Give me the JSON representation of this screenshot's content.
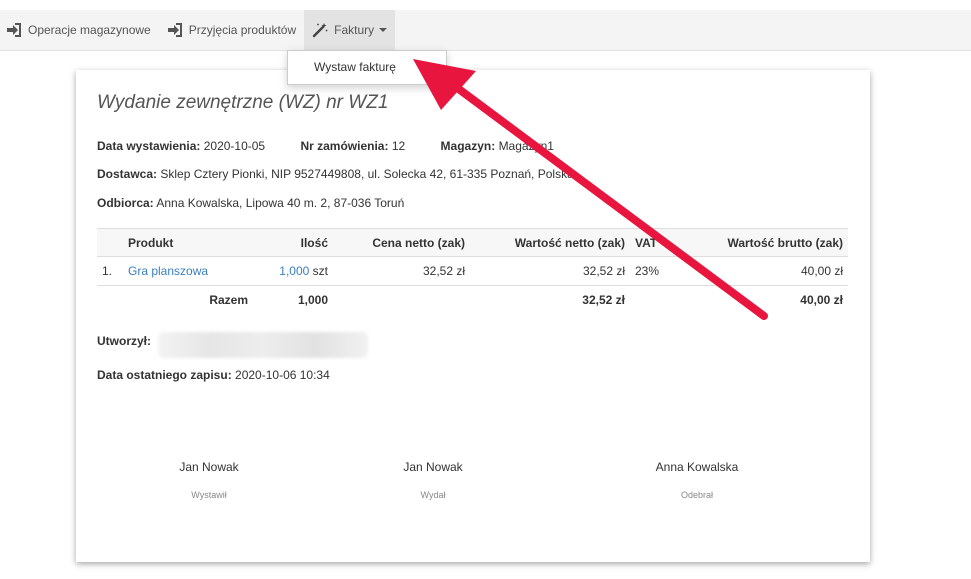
{
  "navbar": {
    "items": [
      {
        "label": "Operacje magazynowe",
        "icon": "sign-in-icon"
      },
      {
        "label": "Przyjęcia produktów",
        "icon": "sign-in-icon"
      },
      {
        "label": "Faktury",
        "icon": "magic-wand-icon"
      }
    ]
  },
  "dropdown": {
    "items": [
      {
        "label": "Wystaw fakturę"
      }
    ]
  },
  "document": {
    "title": "Wydanie zewnętrzne (WZ) nr WZ1",
    "issue_date_label": "Data wystawienia:",
    "issue_date": "2020-10-05",
    "order_no_label": "Nr zamówienia:",
    "order_no": "12",
    "warehouse_label": "Magazyn:",
    "warehouse": "Magazyn1",
    "supplier_label": "Dostawca:",
    "supplier": "Sklep Cztery Pionki, NIP 9527449808, ul. Solecka 42, 61-335 Poznań, Polska",
    "recipient_label": "Odbiorca:",
    "recipient": "Anna Kowalska, Lipowa 40 m. 2, 87-036 Toruń",
    "table": {
      "headers": [
        "Produkt",
        "Ilość",
        "Cena netto (zak)",
        "Wartość netto (zak)",
        "VAT",
        "Wartość brutto (zak)"
      ],
      "rows": [
        {
          "no": "1.",
          "product": "Gra planszowa",
          "qty": "1,000",
          "unit": "szt",
          "price_net": "32,52 zł",
          "value_net": "32,52 zł",
          "vat": "23%",
          "value_gross": "40,00 zł"
        }
      ],
      "total": {
        "label": "Razem",
        "qty": "1,000",
        "value_net": "32,52 zł",
        "value_gross": "40,00 zł"
      }
    },
    "created_by_label": "Utworzył:",
    "last_saved_label": "Data ostatniego zapisu:",
    "last_saved": "2020-10-06 10:34",
    "signatures": [
      {
        "name": "Jan Nowak",
        "role": "Wystawił"
      },
      {
        "name": "Jan Nowak",
        "role": "Wydał"
      },
      {
        "name": "Anna Kowalska",
        "role": "Odebrał"
      }
    ]
  },
  "colors": {
    "link": "#3a7fbf",
    "arrow": "#e8153f",
    "nav_bg": "#f4f4f4"
  }
}
